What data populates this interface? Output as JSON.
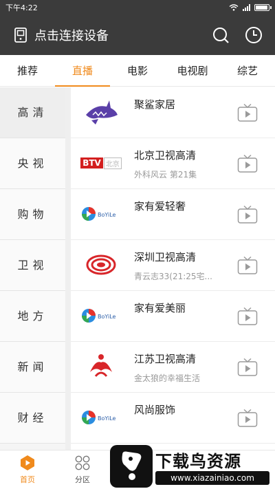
{
  "status": {
    "time": "下午4:22"
  },
  "appbar": {
    "title": "点击连接设备",
    "icons": [
      "cast-icon",
      "search-icon",
      "history-clock-icon"
    ]
  },
  "tabs": [
    {
      "label": "推荐"
    },
    {
      "label": "直播",
      "active": true
    },
    {
      "label": "电影"
    },
    {
      "label": "电视剧"
    },
    {
      "label": "综艺"
    }
  ],
  "sidebar": [
    {
      "label": "高清",
      "active": true
    },
    {
      "label": "央视"
    },
    {
      "label": "购物"
    },
    {
      "label": "卫视"
    },
    {
      "label": "地方"
    },
    {
      "label": "新闻"
    },
    {
      "label": "财经"
    }
  ],
  "channels": [
    {
      "name": "聚鲨家居",
      "program": "",
      "logo": "shark-logo"
    },
    {
      "name": "北京卫视高清",
      "program": "外科风云 第21集",
      "logo": "btv-logo",
      "logo_text": "BTV",
      "logo_text2": "北京"
    },
    {
      "name": "家有爱轻奢",
      "program": "",
      "logo": "boyile-logo",
      "logo_text": "BoYiLe"
    },
    {
      "name": "深圳卫视高清",
      "program": "青云志33(21:25宅...",
      "logo": "shenzhen-logo"
    },
    {
      "name": "家有爱美丽",
      "program": "",
      "logo": "boyile-logo",
      "logo_text": "BoYiLe"
    },
    {
      "name": "江苏卫视高清",
      "program": "金太狼的幸福生活",
      "logo": "jiangsu-logo"
    },
    {
      "name": "风尚服饰",
      "program": "",
      "logo": "boyile-logo",
      "logo_text": "BoYiLe"
    }
  ],
  "bottom_nav": [
    {
      "label": "首页",
      "icon": "home-icon",
      "active": true
    },
    {
      "label": "分区",
      "icon": "category-grid-icon"
    }
  ],
  "watermark": {
    "title": "下载鸟资源",
    "url": "www.xiazainiao.com"
  },
  "colors": {
    "accent": "#f08a1c",
    "topbar": "#3b3b3b"
  }
}
